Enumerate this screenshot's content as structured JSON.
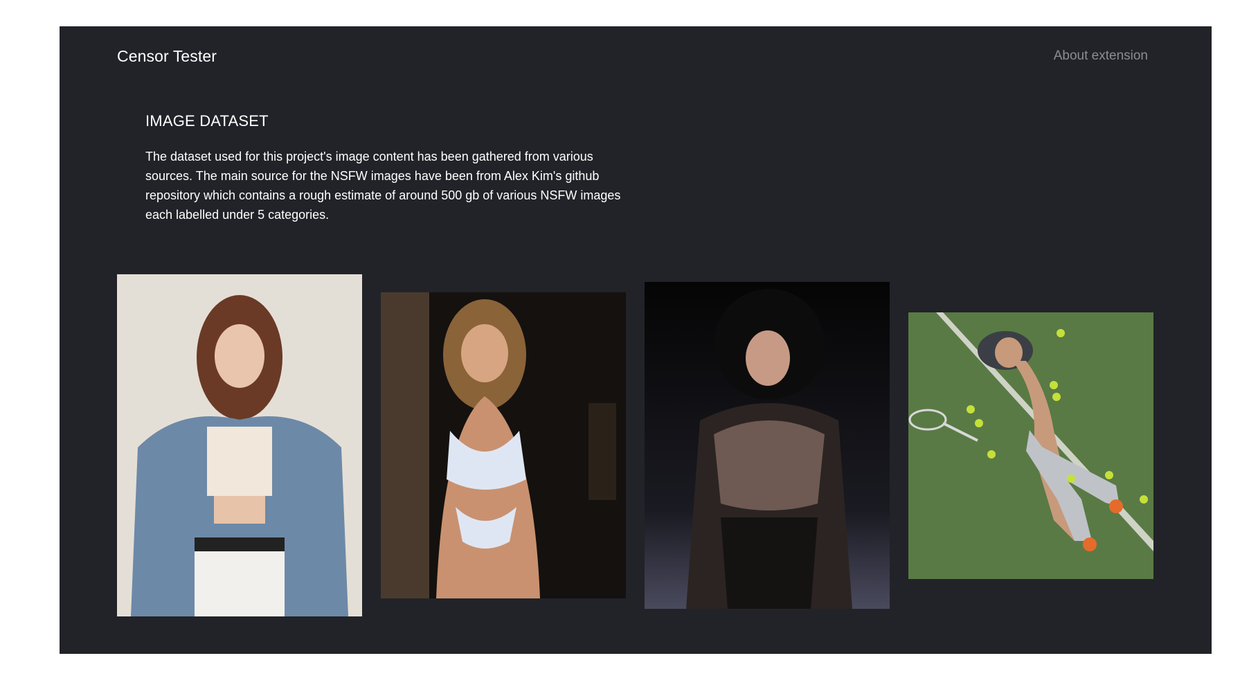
{
  "header": {
    "brand": "Censor Tester",
    "about_link": "About extension"
  },
  "section": {
    "heading": "IMAGE DATASET",
    "body": "The dataset used for this project's image content has been gathered from various sources. The main source for the NSFW images have been from Alex Kim's github repository which contains a rough estimate of around 500 gb of various NSFW images each labelled under 5 categories."
  },
  "gallery": {
    "photos": [
      {
        "icon": "photo-placeholder"
      },
      {
        "icon": "photo-placeholder"
      },
      {
        "icon": "photo-placeholder"
      },
      {
        "icon": "photo-placeholder"
      }
    ]
  },
  "colors": {
    "page_bg": "#ffffff",
    "window_bg": "#212328",
    "text": "#ffffff",
    "muted_link": "#8a8d93"
  }
}
